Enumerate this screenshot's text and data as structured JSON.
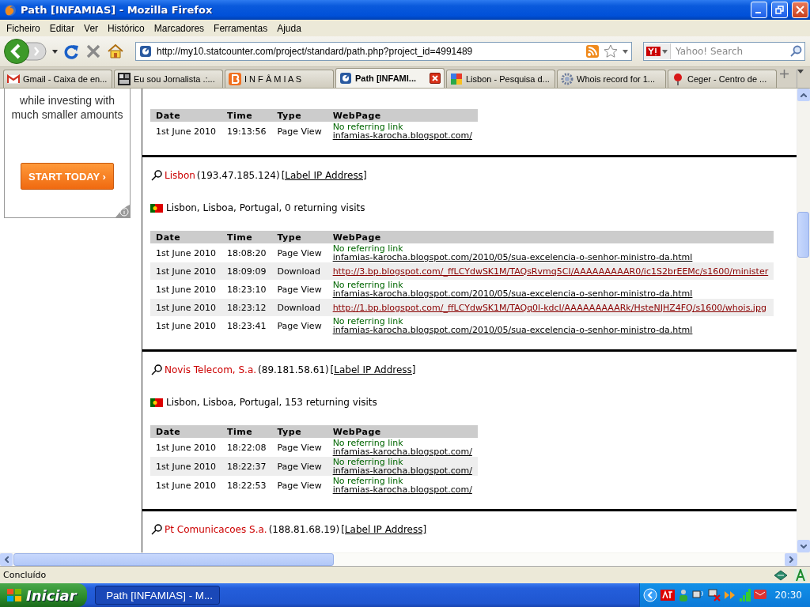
{
  "window": {
    "title": "Path [INFAMIAS] - Mozilla Firefox"
  },
  "menu": [
    "Ficheiro",
    "Editar",
    "Ver",
    "Histórico",
    "Marcadores",
    "Ferramentas",
    "Ajuda"
  ],
  "address_bar": {
    "url": "http://my10.statcounter.com/project/standard/path.php?project_id=4991489"
  },
  "search": {
    "placeholder": "Yahoo! Search"
  },
  "tabs": [
    {
      "label": "Gmail - Caixa de en...",
      "selected": false
    },
    {
      "label": "Eu sou Jornalista .:...",
      "selected": false
    },
    {
      "label": "I N F Â M I A S",
      "selected": false
    },
    {
      "label": "Path [INFAMI...",
      "selected": true
    },
    {
      "label": "Lisbon - Pesquisa d...",
      "selected": false
    },
    {
      "label": "Whois record for 1...",
      "selected": false
    },
    {
      "label": "Ceger - Centro de ...",
      "selected": false
    }
  ],
  "ad": {
    "text": "while investing with much smaller amounts",
    "button": "START TODAY ›"
  },
  "visits": [
    {
      "table": {
        "columns": [
          "Date",
          "Time",
          "Type",
          "WebPage"
        ],
        "rows": [
          {
            "kind": "page_view",
            "date": "1st June 2010",
            "time": "19:13:56",
            "type": "Page View",
            "referrer": "No referring link",
            "page": "infamias-karocha.blogspot.com/"
          }
        ]
      }
    },
    {
      "name": "Lisbon",
      "ip": "(193.47.185.124)",
      "action": "[Label IP Address]",
      "location": "Lisbon, Lisboa, Portugal, 0 returning visits",
      "table": {
        "columns": [
          "Date",
          "Time",
          "Type",
          "WebPage"
        ],
        "rows": [
          {
            "kind": "page_view",
            "date": "1st June 2010",
            "time": "18:08:20",
            "type": "Page View",
            "referrer": "No referring link",
            "page": "infamias-karocha.blogspot.com/2010/05/sua-excelencia-o-senhor-ministro-da.html"
          },
          {
            "kind": "download",
            "date": "1st June 2010",
            "time": "18:09:09",
            "type": "Download",
            "page": "http://3.bp.blogspot.com/_ffLCYdwSK1M/TAQsRvmq5CI/AAAAAAAAAR0/ic1S2brEEMc/s1600/minister"
          },
          {
            "kind": "page_view",
            "date": "1st June 2010",
            "time": "18:23:10",
            "type": "Page View",
            "referrer": "No referring link",
            "page": "infamias-karocha.blogspot.com/2010/05/sua-excelencia-o-senhor-ministro-da.html"
          },
          {
            "kind": "download",
            "date": "1st June 2010",
            "time": "18:23:12",
            "type": "Download",
            "page": "http://1.bp.blogspot.com/_ffLCYdwSK1M/TAQq0l-kdcI/AAAAAAAAARk/HsteNJHZ4FQ/s1600/whois.jpg"
          },
          {
            "kind": "page_view",
            "date": "1st June 2010",
            "time": "18:23:41",
            "type": "Page View",
            "referrer": "No referring link",
            "page": "infamias-karocha.blogspot.com/2010/05/sua-excelencia-o-senhor-ministro-da.html"
          }
        ]
      }
    },
    {
      "name": "Novis Telecom, S.a.",
      "ip": "(89.181.58.61)",
      "action": "[Label IP Address]",
      "location": "Lisbon, Lisboa, Portugal, 153 returning visits",
      "table": {
        "columns": [
          "Date",
          "Time",
          "Type",
          "WebPage"
        ],
        "rows": [
          {
            "kind": "page_view",
            "date": "1st June 2010",
            "time": "18:22:08",
            "type": "Page View",
            "referrer": "No referring link",
            "page": "infamias-karocha.blogspot.com/"
          },
          {
            "kind": "page_view",
            "date": "1st June 2010",
            "time": "18:22:37",
            "type": "Page View",
            "referrer": "No referring link",
            "page": "infamias-karocha.blogspot.com/"
          },
          {
            "kind": "page_view",
            "date": "1st June 2010",
            "time": "18:22:53",
            "type": "Page View",
            "referrer": "No referring link",
            "page": "infamias-karocha.blogspot.com/"
          }
        ]
      }
    },
    {
      "name": "Pt Comunicacoes S.a.",
      "ip": "(188.81.68.19)",
      "action": "[Label IP Address]"
    }
  ],
  "status_bar": {
    "text": "Concluído"
  },
  "taskbar": {
    "start": "Iniciar",
    "tasks": [
      {
        "label": "Path [INFAMIAS] - M...",
        "selected": true
      }
    ],
    "clock": "20:30"
  }
}
